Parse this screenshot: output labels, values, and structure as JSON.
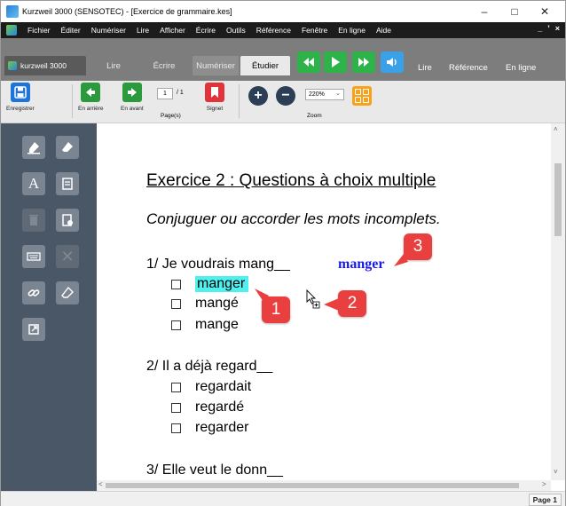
{
  "window": {
    "title": "Kurzweil 3000 (SENSOTEC) - [Exercice de grammaire.kes]",
    "controls": [
      "–",
      "□",
      "✕"
    ]
  },
  "menu": {
    "items": [
      "Fichier",
      "Éditer",
      "Numériser",
      "Lire",
      "Afficher",
      "Écrire",
      "Outils",
      "Référence",
      "Fenêtre",
      "En ligne",
      "Aide"
    ],
    "right_controls": [
      "_",
      "Д",
      "×"
    ]
  },
  "tabs": {
    "brand": "kurzweil 3000",
    "items": [
      "Lire",
      "Écrire",
      "Numériser",
      "Étudier"
    ],
    "active": "Étudier",
    "right_links": [
      "Lire",
      "Référence",
      "En ligne"
    ]
  },
  "toolbar": {
    "save_label": "Enregistrer",
    "back_label": "En arrière",
    "forward_label": "En avant",
    "page_value": "1",
    "page_total": "/ 1",
    "pages_label": "Page(s)",
    "bookmark_label": "Signet",
    "zoom_value": "220%",
    "zoom_label": "Zoom"
  },
  "document": {
    "title": "Exercice 2 : Questions à choix multiple",
    "instruction": "Conjuguer ou accorder les mots incomplets.",
    "questions": [
      {
        "prompt": "1/  Je voudrais mang__",
        "answer": "manger",
        "options": [
          "manger",
          "mangé",
          "mange"
        ],
        "highlighted": "manger"
      },
      {
        "prompt": "2/  Il a déjà regard__",
        "options": [
          "regardait",
          "regardé",
          "regarder"
        ]
      },
      {
        "prompt": "3/  Elle veut le donn__"
      }
    ]
  },
  "annotations": {
    "badges": [
      "1",
      "2",
      "3"
    ],
    "color": "#ea3f3f"
  },
  "status": {
    "page_indicator": "Page 1"
  },
  "colors": {
    "menu_bg": "#1c1c1c",
    "tab_bg": "#7d7d7d",
    "media_green": "#2eb34a",
    "panel_bg": "#4a5766",
    "highlight": "#4ff0f0",
    "answer_blue": "#1a1ae6"
  }
}
